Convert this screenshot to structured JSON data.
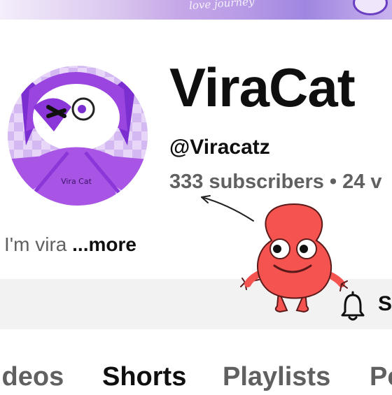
{
  "channel": {
    "name": "ViraCat",
    "handle": "@Viracatz",
    "stats": "333 subscribers • 24 v",
    "description": "I'm vira",
    "more_label": "...more"
  },
  "avatar": {
    "shirt_text": "Vira Cat"
  },
  "banner": {
    "script_text": "love journey"
  },
  "action_bar": {
    "subscribe_label": "S"
  },
  "tabs": [
    {
      "label": "ideos",
      "active": false
    },
    {
      "label": "Shorts",
      "active": true
    },
    {
      "label": "Playlists",
      "active": false
    },
    {
      "label": "Po",
      "active": false
    }
  ],
  "colors": {
    "avatar_purple": "#a855e6",
    "avatar_bg": "#dcc5f4",
    "sticker_red": "#f4534f",
    "text_primary": "#0f0f0f",
    "text_secondary": "#606060"
  },
  "icons": [
    "bell-icon",
    "pointer-arrow"
  ]
}
